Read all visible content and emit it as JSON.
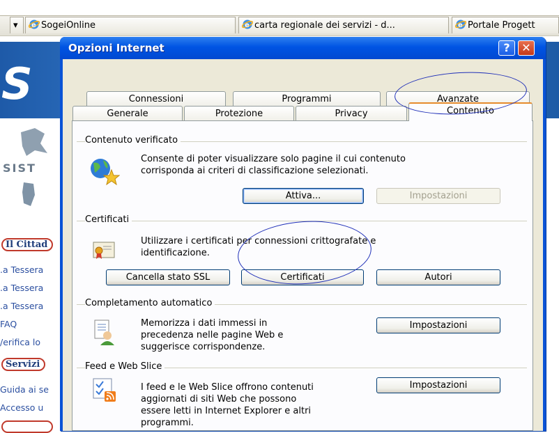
{
  "browser_tabs": [
    {
      "label": "SogeiOnline"
    },
    {
      "label": "carta regionale dei servizi - d..."
    },
    {
      "label": "Portale Progett"
    }
  ],
  "background_page": {
    "logo": "S",
    "sist": "SIST",
    "section_cittadino": "Il Cittad",
    "cittadino_links": [
      ".a Tessera",
      ".a Tessera",
      ".a Tessera",
      "FAQ",
      "/erifica lo"
    ],
    "section_servizi": "Servizi",
    "servizi_links": [
      "Guida ai se",
      "Accesso u"
    ]
  },
  "dialog": {
    "title": "Opzioni Internet",
    "help_glyph": "?",
    "close_glyph": "✕",
    "tabs_back_row": [
      "Connessioni",
      "Programmi",
      "Avanzate"
    ],
    "tabs_front_row": [
      "Generale",
      "Protezione",
      "Privacy",
      "Contenuto"
    ],
    "active_tab": "Contenuto",
    "groups": {
      "content_advisor": {
        "label": "Contenuto verificato",
        "description_line1": "Consente di poter visualizzare solo pagine il cui contenuto",
        "description_line2": "corrisponda ai criteri di classificazione selezionati.",
        "enable_button": "Attiva...",
        "settings_button": "Impostazioni"
      },
      "certificates": {
        "label": "Certificati",
        "description_line1": "Utilizzare i certificati per connessioni crittografate e",
        "description_line2": "identificazione.",
        "clear_ssl_button": "Cancella stato SSL",
        "certificates_button": "Certificati",
        "publishers_button": "Autori"
      },
      "autocomplete": {
        "label": "Completamento automatico",
        "description_line1": "Memorizza i dati immessi in",
        "description_line2": "precedenza nelle pagine Web e",
        "description_line3": "suggerisce corrispondenze.",
        "settings_button": "Impostazioni"
      },
      "feeds": {
        "label": "Feed e Web Slice",
        "description_line1": "I feed e le Web Slice offrono contenuti",
        "description_line2": "aggiornati di siti Web che possono",
        "description_line3": "essere letti in Internet Explorer e altri",
        "description_line4": "programmi.",
        "settings_button": "Impostazioni"
      }
    }
  },
  "colors": {
    "titlebar": "#0054e3",
    "dialog_face": "#ece9d8",
    "tab_active_accent": "#e68b2c",
    "annotation_ellipse": "#1f2fb8"
  }
}
